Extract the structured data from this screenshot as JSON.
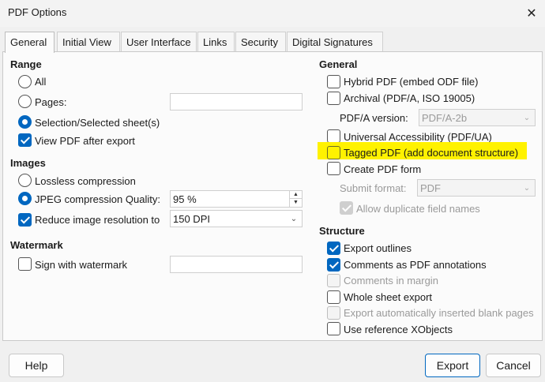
{
  "window": {
    "title": "PDF Options",
    "close_icon": "close-icon"
  },
  "tabs": [
    "General",
    "Initial View",
    "User Interface",
    "Links",
    "Security",
    "Digital Signatures"
  ],
  "left": {
    "range": {
      "title": "Range",
      "all": "All",
      "pages": "Pages:",
      "selection": "Selection/Selected sheet(s)",
      "view_pdf": "View PDF after export"
    },
    "images": {
      "title": "Images",
      "lossless": "Lossless compression",
      "jpeg": "JPEG compression Quality:",
      "jpeg_value": "95 %",
      "reduce": "Reduce image resolution to",
      "reduce_value": "150 DPI"
    },
    "watermark": {
      "title": "Watermark",
      "sign": "Sign with watermark"
    }
  },
  "right": {
    "general": {
      "title": "General",
      "hybrid": "Hybrid PDF (embed ODF file)",
      "archival": "Archival (PDF/A, ISO 19005)",
      "pdfa_version_label": "PDF/A version:",
      "pdfa_version_value": "PDF/A-2b",
      "universal": "Universal Accessibility (PDF/UA)",
      "tagged": "Tagged PDF (add document structure)",
      "create_form": "Create PDF form",
      "submit_label": "Submit format:",
      "submit_value": "PDF",
      "allow_dup": "Allow duplicate field names"
    },
    "structure": {
      "title": "Structure",
      "export_outlines": "Export outlines",
      "comments_annotations": "Comments as PDF annotations",
      "comments_margin": "Comments in margin",
      "whole_sheet": "Whole sheet export",
      "export_blank": "Export automatically inserted blank pages",
      "use_xobjects": "Use reference XObjects"
    }
  },
  "buttons": {
    "help": "Help",
    "export": "Export",
    "cancel": "Cancel"
  },
  "colors": {
    "accent": "#0067c0",
    "highlight": "#fff200"
  }
}
